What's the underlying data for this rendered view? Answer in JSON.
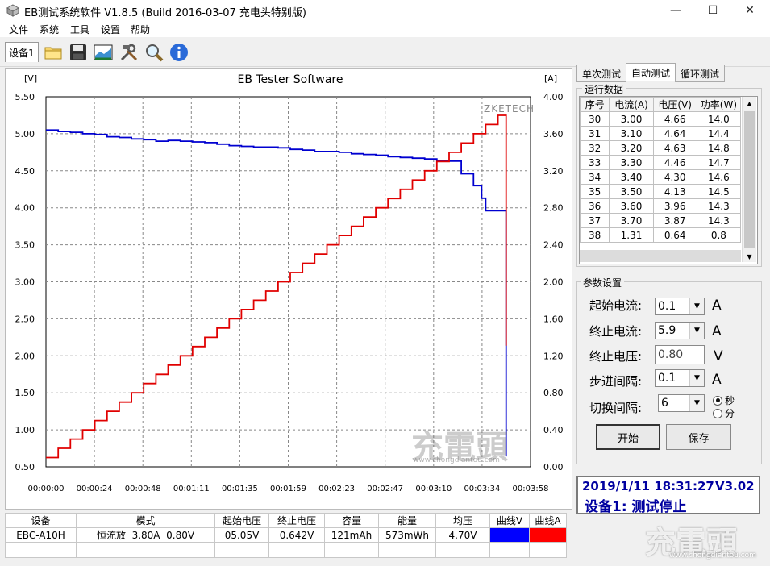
{
  "window": {
    "title": "EB测试系统软件 V1.8.5 (Build 2016-03-07 充电头特别版)",
    "minimize": "—",
    "maximize": "☐",
    "close": "✕"
  },
  "menu": [
    "文件",
    "系统",
    "工具",
    "设置",
    "帮助"
  ],
  "toolbar": {
    "device_tab": "设备1",
    "icons": [
      "folder-icon",
      "save-icon",
      "chart-image-icon",
      "tools-icon",
      "magnifier-icon",
      "info-icon"
    ]
  },
  "chart_data": {
    "type": "line",
    "title": "EB Tester Software",
    "watermark": "ZKETECH",
    "y_left_unit": "[V]",
    "y_right_unit": "[A]",
    "y_left_ticks": [
      "5.50",
      "5.00",
      "4.50",
      "4.00",
      "3.50",
      "3.00",
      "2.50",
      "2.00",
      "1.50",
      "1.00",
      "0.50"
    ],
    "y_right_ticks": [
      "4.00",
      "3.60",
      "3.20",
      "2.80",
      "2.40",
      "2.00",
      "1.60",
      "1.20",
      "0.80",
      "0.40",
      "0.00"
    ],
    "x_ticks": [
      "00:00:00",
      "00:00:24",
      "00:00:48",
      "00:01:11",
      "00:01:35",
      "00:01:59",
      "00:02:23",
      "00:02:47",
      "00:03:10",
      "00:03:34",
      "00:03:58"
    ],
    "ylim_left": [
      0.5,
      5.5
    ],
    "ylim_right": [
      0,
      4
    ],
    "xlim_seconds": [
      0,
      238
    ],
    "series": [
      {
        "name": "曲线V",
        "color": "#0000d0",
        "axis": "left",
        "x": [
          0,
          6,
          12,
          18,
          24,
          30,
          36,
          42,
          48,
          54,
          60,
          66,
          72,
          78,
          84,
          90,
          96,
          102,
          108,
          114,
          120,
          126,
          132,
          138,
          144,
          150,
          156,
          162,
          168,
          174,
          180,
          186,
          192,
          198,
          204,
          210,
          214,
          216,
          226
        ],
        "y": [
          5.05,
          5.03,
          5.02,
          5.0,
          4.99,
          4.96,
          4.95,
          4.93,
          4.92,
          4.9,
          4.91,
          4.9,
          4.89,
          4.88,
          4.86,
          4.84,
          4.83,
          4.82,
          4.82,
          4.81,
          4.79,
          4.78,
          4.76,
          4.76,
          4.75,
          4.73,
          4.72,
          4.71,
          4.69,
          4.68,
          4.67,
          4.66,
          4.64,
          4.63,
          4.46,
          4.3,
          4.13,
          3.96,
          0.64
        ]
      },
      {
        "name": "曲线A",
        "color": "#e00000",
        "axis": "right",
        "x": [
          0,
          6,
          12,
          18,
          24,
          30,
          36,
          42,
          48,
          54,
          60,
          66,
          72,
          78,
          84,
          90,
          96,
          102,
          108,
          114,
          120,
          126,
          132,
          138,
          144,
          150,
          156,
          162,
          168,
          174,
          180,
          186,
          192,
          198,
          204,
          210,
          216,
          222,
          226
        ],
        "y": [
          0.1,
          0.2,
          0.3,
          0.4,
          0.5,
          0.6,
          0.7,
          0.8,
          0.9,
          1.0,
          1.1,
          1.2,
          1.3,
          1.4,
          1.5,
          1.6,
          1.7,
          1.8,
          1.9,
          2.0,
          2.1,
          2.2,
          2.3,
          2.4,
          2.5,
          2.6,
          2.7,
          2.8,
          2.9,
          3.0,
          3.1,
          3.2,
          3.3,
          3.4,
          3.5,
          3.6,
          3.7,
          3.8,
          1.31
        ]
      }
    ]
  },
  "side_tabs": [
    "单次测试",
    "自动测试",
    "循环测试"
  ],
  "run_data": {
    "label": "运行数据",
    "columns": [
      "序号",
      "电流(A)",
      "电压(V)",
      "功率(W)"
    ],
    "rows": [
      [
        "30",
        "3.00",
        "4.66",
        "14.0"
      ],
      [
        "31",
        "3.10",
        "4.64",
        "14.4"
      ],
      [
        "32",
        "3.20",
        "4.63",
        "14.8"
      ],
      [
        "33",
        "3.30",
        "4.46",
        "14.7"
      ],
      [
        "34",
        "3.40",
        "4.30",
        "14.6"
      ],
      [
        "35",
        "3.50",
        "4.13",
        "14.5"
      ],
      [
        "36",
        "3.60",
        "3.96",
        "14.3"
      ],
      [
        "37",
        "3.70",
        "3.87",
        "14.3"
      ],
      [
        "38",
        "1.31",
        "0.64",
        "0.8"
      ]
    ]
  },
  "params": {
    "label": "参数设置",
    "start_current_label": "起始电流:",
    "start_current_value": "0.1",
    "start_current_unit": "A",
    "end_current_label": "终止电流:",
    "end_current_value": "5.9",
    "end_current_unit": "A",
    "end_voltage_label": "终止电压:",
    "end_voltage_value": "0.80",
    "end_voltage_unit": "V",
    "step_label": "步进间隔:",
    "step_value": "0.1",
    "step_unit": "A",
    "switch_label": "切换间隔:",
    "switch_value": "6",
    "unit_sec": "秒",
    "unit_min": "分",
    "start_button": "开始",
    "save_button": "保存"
  },
  "status": {
    "datetime": "2019/1/11 18:31:27",
    "version": "V3.02",
    "message": "设备1: 测试停止"
  },
  "summary": {
    "columns": [
      "设备",
      "模式",
      "起始电压",
      "终止电压",
      "容量",
      "能量",
      "均压",
      "曲线V",
      "曲线A"
    ],
    "row": [
      "EBC-A10H",
      "恒流放  3.80A  0.80V",
      "05.05V",
      "0.642V",
      "121mAh",
      "573mWh",
      "4.70V",
      "",
      ""
    ],
    "curve_v_color": "#0000ff",
    "curve_a_color": "#ff0000"
  },
  "watermark": {
    "logo_text": "充電頭",
    "site": "www.chongdiantou.com"
  }
}
